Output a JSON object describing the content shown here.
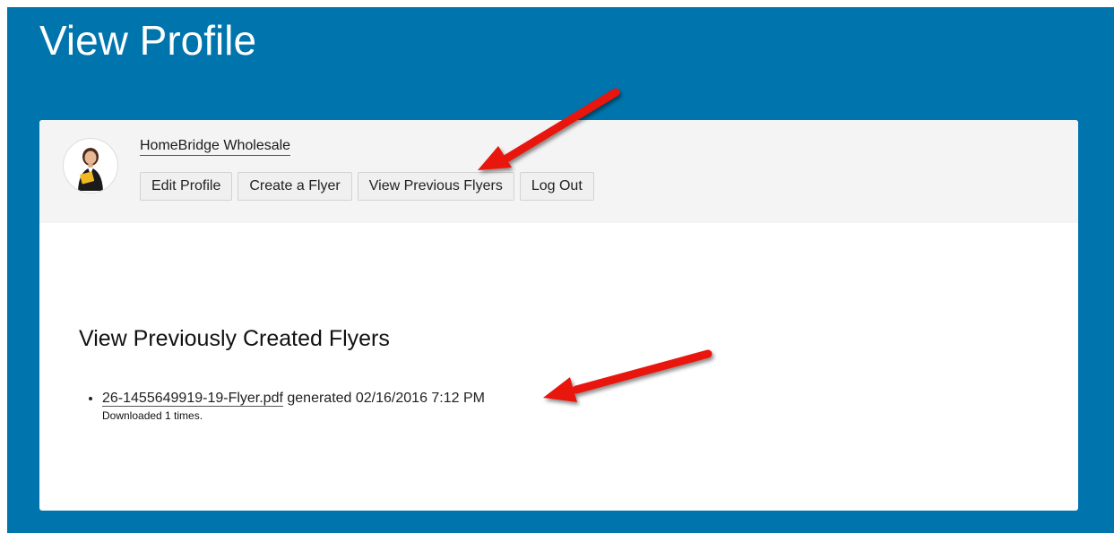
{
  "page": {
    "title": "View Profile"
  },
  "profile": {
    "name": "HomeBridge Wholesale",
    "actions": [
      {
        "label": "Edit Profile"
      },
      {
        "label": "Create a Flyer"
      },
      {
        "label": "View Previous Flyers"
      },
      {
        "label": "Log Out"
      }
    ]
  },
  "flyers": {
    "heading": "View Previously Created Flyers",
    "items": [
      {
        "filename": "26-1455649919-19-Flyer.pdf",
        "generated_text": "generated 02/16/2016 7:12 PM",
        "downloads_text": "Downloaded 1 times."
      }
    ]
  },
  "colors": {
    "frame": "#0075ad",
    "header_panel": "#f4f4f4",
    "annotation_arrow": "#e8120c"
  },
  "icons": {
    "avatar": "user-avatar-icon",
    "annotation": "red-arrow-icon"
  }
}
